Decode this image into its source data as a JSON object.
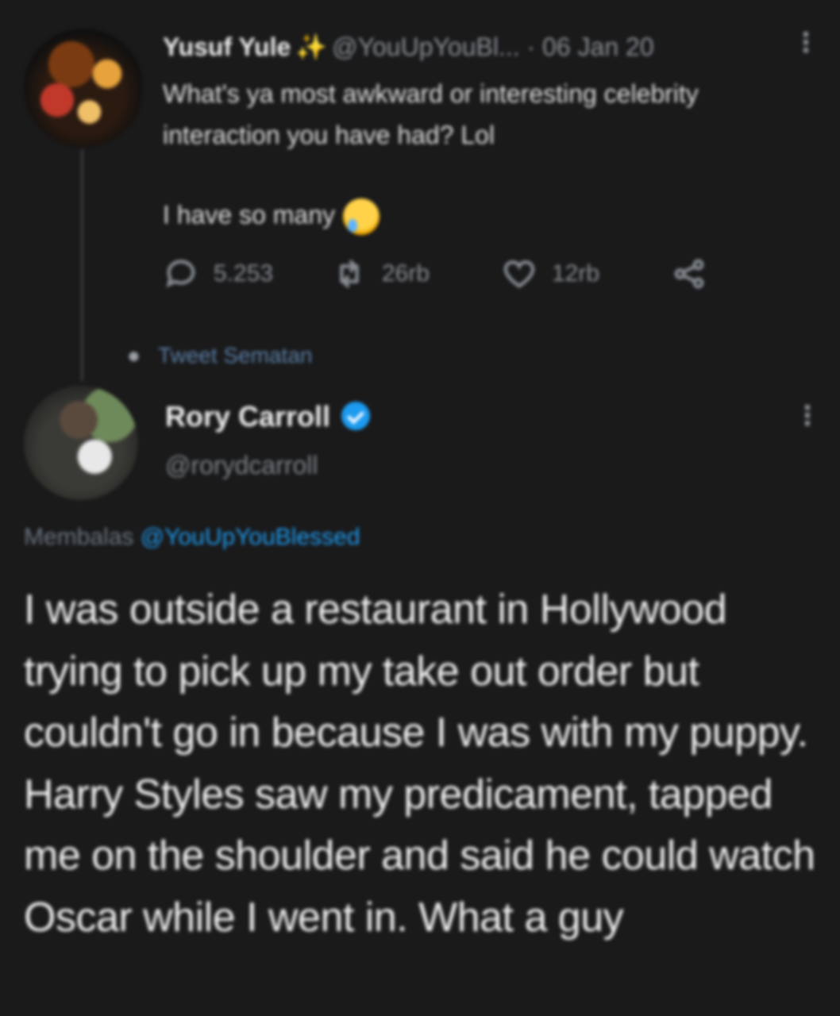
{
  "parent_tweet": {
    "author_name": "Yusuf Yule",
    "handle": "@YouUpYouBl...",
    "separator": "·",
    "date": "06 Jan 20",
    "text": "What's ya most awkward or interesting celebrity interaction you have had? Lol",
    "text2": "I have so many",
    "emoji": "loudly-crying-face",
    "replies": "5.253",
    "retweets": "26rb",
    "likes": "12rb"
  },
  "thread_label": "Tweet Sematan",
  "reply_tweet": {
    "author_name": "Rory Carroll",
    "handle": "@rorydcarroll",
    "replying_prefix": "Membalas",
    "replying_to": "@YouUpYouBlessed",
    "text": "I was outside a restaurant in Hollywood trying to pick up my take out order but couldn't go in because I was with my puppy. Harry Styles saw my predicament, tapped me on the shoulder and said he could watch Oscar while I went in. What a guy"
  },
  "colors": {
    "background": "#1a1a1b",
    "verified": "#1d9bf0",
    "star": "#f5b400",
    "muted": "#8a8f95"
  }
}
